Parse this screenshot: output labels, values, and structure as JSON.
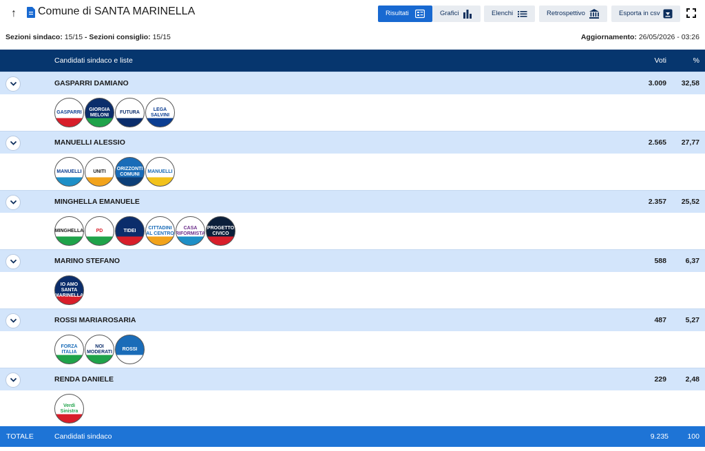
{
  "header": {
    "title": "Comune di SANTA MARINELLA",
    "buttons": {
      "results": "Risultati",
      "charts": "Grafici",
      "lists": "Elenchi",
      "retro": "Retrospettivo",
      "csv": "Esporta in csv"
    }
  },
  "info": {
    "sezioni_sindaco_label": "Sezioni sindaco:",
    "sezioni_sindaco_value": "15/15",
    "separator": "-",
    "sezioni_consiglio_label": "Sezioni consiglio:",
    "sezioni_consiglio_value": "15/15",
    "aggiornamento_label": "Aggiornamento:",
    "aggiornamento_value": "26/05/2026 - 03:26"
  },
  "table": {
    "col_name": "Candidati sindaco e liste",
    "col_votes": "Voti",
    "col_pct": "%",
    "candidates": [
      {
        "name": "GASPARRI DAMIANO",
        "votes": "3.009",
        "pct": "32,58",
        "logos": [
          {
            "text": "GASPARRI",
            "bg": "#ffffff",
            "fg": "#0b3d91",
            "accent": "#d81e2a"
          },
          {
            "text": "GIORGIA MELONI",
            "bg": "#0b2d6b",
            "fg": "#ffffff",
            "accent": "#1fa34a"
          },
          {
            "text": "FUTURA",
            "bg": "#ffffff",
            "fg": "#0b2d6b",
            "accent": "#0b2d6b"
          },
          {
            "text": "LEGA SALVINI",
            "bg": "#ffffff",
            "fg": "#0b3d91",
            "accent": "#0b3d91"
          }
        ]
      },
      {
        "name": "MANUELLI ALESSIO",
        "votes": "2.565",
        "pct": "27,77",
        "logos": [
          {
            "text": "MANUELLI",
            "bg": "#ffffff",
            "fg": "#0b3d91",
            "accent": "#1e8fc7"
          },
          {
            "text": "UNITI",
            "bg": "#ffffff",
            "fg": "#1a1a1a",
            "accent": "#f2a31b"
          },
          {
            "text": "ORIZZONTI COMUNI",
            "bg": "#1a6cb8",
            "fg": "#ffffff",
            "accent": "#0d3f78"
          },
          {
            "text": "MANUELLI",
            "bg": "#ffffff",
            "fg": "#1a6cb8",
            "accent": "#f2c21b"
          }
        ]
      },
      {
        "name": "MINGHELLA EMANUELE",
        "votes": "2.357",
        "pct": "25,52",
        "logos": [
          {
            "text": "MINGHELLA",
            "bg": "#ffffff",
            "fg": "#1a1a1a",
            "accent": "#1fa34a"
          },
          {
            "text": "PD",
            "bg": "#ffffff",
            "fg": "#d81e2a",
            "accent": "#1fa34a"
          },
          {
            "text": "TIDEI",
            "bg": "#0b2d6b",
            "fg": "#ffffff",
            "accent": "#d81e2a"
          },
          {
            "text": "CITTADINI AL CENTRO",
            "bg": "#ffffff",
            "fg": "#1a6cb8",
            "accent": "#f2a31b"
          },
          {
            "text": "CASA RIFORMISTA",
            "bg": "#ffffff",
            "fg": "#6b2d8a",
            "accent": "#1e8fc7"
          },
          {
            "text": "PROGETTO CIVICO",
            "bg": "#0b1f3a",
            "fg": "#ffffff",
            "accent": "#d81e2a"
          }
        ]
      },
      {
        "name": "MARINO STEFANO",
        "votes": "588",
        "pct": "6,37",
        "logos": [
          {
            "text": "IO AMO SANTA MARINELLA",
            "bg": "#0b2d6b",
            "fg": "#ffffff",
            "accent": "#d81e2a"
          }
        ]
      },
      {
        "name": "ROSSI MARIAROSARIA",
        "votes": "487",
        "pct": "5,27",
        "logos": [
          {
            "text": "FORZA ITALIA",
            "bg": "#ffffff",
            "fg": "#1a6cb8",
            "accent": "#1fa34a"
          },
          {
            "text": "NOI MODERATI",
            "bg": "#ffffff",
            "fg": "#0b2d6b",
            "accent": "#1fa34a"
          },
          {
            "text": "ROSSI",
            "bg": "#1a6cb8",
            "fg": "#ffffff",
            "accent": "#ffffff"
          }
        ]
      },
      {
        "name": "RENDA DANIELE",
        "votes": "229",
        "pct": "2,48",
        "logos": [
          {
            "text": "Verdi Sinistra",
            "bg": "#ffffff",
            "fg": "#1fa34a",
            "accent": "#d81e2a"
          }
        ]
      }
    ]
  },
  "total": {
    "label": "TOTALE",
    "desc": "Candidati sindaco",
    "votes": "9.235",
    "pct": "100"
  }
}
